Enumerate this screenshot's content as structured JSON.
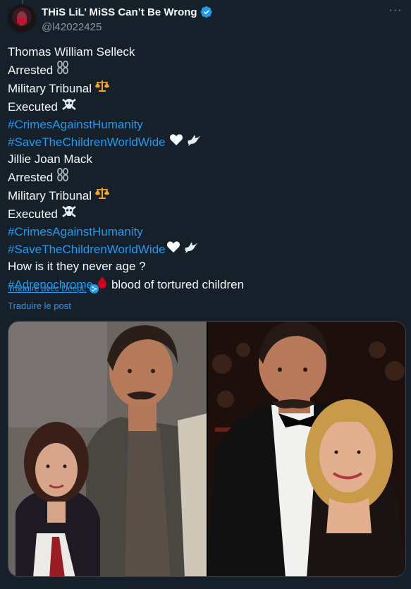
{
  "author": {
    "display_name": "THiS LiL’ MiSS Can’t Be Wrong",
    "handle": "@l42022425",
    "verified": true
  },
  "icons": {
    "verified": "verified-badge-icon",
    "more": "more-options-icon",
    "arrested": "chains-icon",
    "tribunal": "scales-icon",
    "executed": "skull-crossbones-icon",
    "heart": "white-heart-icon",
    "dove": "dove-icon",
    "blood": "blood-drop-icon",
    "deepl": "deepl-icon"
  },
  "tweet": {
    "lines": [
      {
        "text": "Thomas William Selleck"
      },
      {
        "text": "Arrested",
        "emoji": "⛓"
      },
      {
        "text": "Military Tribunal",
        "emoji": "⚖"
      },
      {
        "text": "Executed",
        "emoji": "☠"
      },
      {
        "text": "#CrimesAgainstHumanity"
      },
      {
        "text": "#SaveTheChildrenWorldWide"
      },
      {
        "text": "Jillie Joan Mack"
      },
      {
        "text": "Arrested",
        "emoji": "⛓"
      },
      {
        "text": "Military Tribunal",
        "emoji": "⚖"
      },
      {
        "text": "Executed",
        "emoji": "☠"
      },
      {
        "text": "#CrimesAgainstHumanity"
      },
      {
        "text": "#SaveTheChildrenWorldWide"
      },
      {
        "text": "How is it they never age ?"
      },
      {
        "text": "#Adrenochrome",
        "trailing": "blood of tortured children"
      }
    ]
  },
  "actions": {
    "translate_deepl": "Traduire avec DeepL",
    "translate_post": "Traduire le post"
  },
  "colors": {
    "background": "#15202b",
    "text": "#f7f9f9",
    "secondary": "#8b98a5",
    "link": "#1d9bf0",
    "border": "#38444d"
  }
}
